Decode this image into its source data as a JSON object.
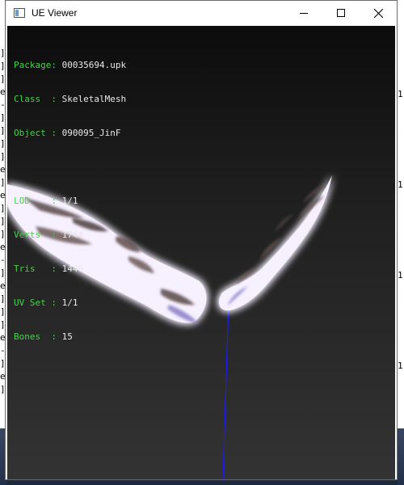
{
  "window": {
    "title": "UE Viewer",
    "icon": "app-window-icon",
    "controls": [
      "minimize-icon",
      "maximize-icon",
      "close-icon"
    ]
  },
  "info": {
    "package": {
      "label": "Package: ",
      "value": "00035694.upk"
    },
    "class": {
      "label": "Class  : ",
      "value": "SkeletalMesh"
    },
    "object": {
      "label": "Object : ",
      "value": "090095_JinF"
    },
    "lod": {
      "label": "LOD    : ",
      "value": "1/1"
    },
    "verts": {
      "label": "Verts  : ",
      "value": "1744"
    },
    "tris": {
      "label": "Tris   : ",
      "value": "1446"
    },
    "uvset": {
      "label": "UV Set : ",
      "value": "1/1"
    },
    "bones": {
      "label": "Bones  : ",
      "value": "15"
    }
  },
  "background_fragments": {
    "left": [
      "]",
      "]",
      "]",
      "e",
      "-",
      "]",
      "]",
      "]",
      "]",
      "e",
      "]",
      "e",
      "]",
      "]",
      "]",
      "e",
      "-",
      "]",
      "e",
      "]",
      "]",
      "]",
      "e",
      "-",
      "]",
      "e",
      "]"
    ],
    "right": [
      "1",
      "1",
      "1",
      "1"
    ]
  },
  "colors": {
    "label_green": "#47d14a",
    "value_white": "#e8e8e8",
    "bone_blue": "#1a1aff"
  }
}
